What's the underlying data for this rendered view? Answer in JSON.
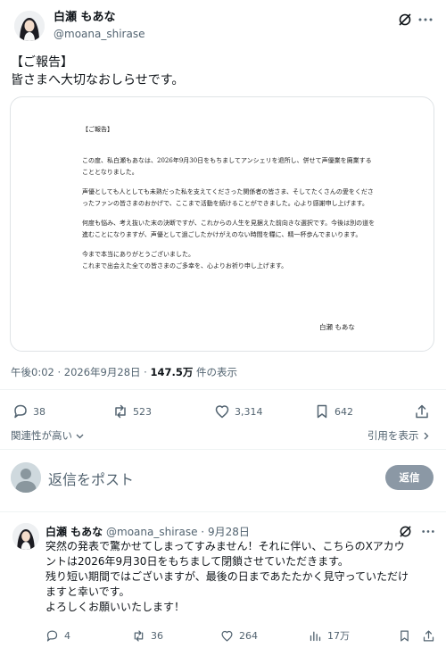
{
  "post": {
    "display_name": "白瀬 もあな",
    "handle": "@moana_shirase",
    "text_line1": "【ご報告】",
    "text_line2": "皆さまへ大切なおしらせです。"
  },
  "document": {
    "heading": "【ご報告】",
    "para1": "この度、私白瀬もあなは、2026年9月30日をもちましてアンシェリを退所し、併せて声優業を廃業することとなりました。",
    "para2": "声優としても人としても未熟だった私を支えてくださった関係者の皆さま、そしてたくさんの愛をくださったファンの皆さまのおかげで、ここまで活動を続けることができました。心より感謝申し上げます。",
    "para3": "何度も悩み、考え抜いた末の決断ですが、これからの人生を見据えた前向きな選択です。今後は別の道を進むことになりますが、声優として過ごしたかけがえのない時間を糧に、精一杯歩んでまいります。",
    "para4_line1": "今まで本当にありがとうございました。",
    "para4_line2": "これまで出会えた全ての皆さまのご多幸を、心よりお祈り申し上げます。",
    "signature": "白瀬 もあな"
  },
  "meta": {
    "time": "午後0:02 · 2026年9月28日 · ",
    "views_count": "147.5万",
    "views_label": " 件の表示"
  },
  "actions": {
    "replies": "38",
    "reposts": "523",
    "likes": "3,314",
    "bookmarks": "642"
  },
  "sort": {
    "relevance": "関連性が高い",
    "quotes": "引用を表示"
  },
  "composer": {
    "placeholder": "返信をポスト",
    "button": "返信"
  },
  "reply": {
    "display_name": "白瀬 もあな",
    "handle": "@moana_shirase",
    "separator": " · ",
    "date": "9月28日",
    "line1": "突然の発表で驚かせてしまってすみません！それに伴い、こちらのXアカウ",
    "line2": "ントは2026年9月30日をもちまして閉鎖させていただきます。",
    "line3": "残り短い期間ではございますが、最後の日まであたたかく見守っていただけ",
    "line4": "ますと幸いです。",
    "line5": "よろしくお願いいたします！",
    "replies": "4",
    "reposts": "36",
    "likes": "264",
    "views": "17万"
  },
  "icons": {
    "grok": "grok-icon",
    "more": "more-icon",
    "reply": "reply-icon",
    "repost": "repost-icon",
    "like": "like-icon",
    "bookmark": "bookmark-icon",
    "share": "share-icon",
    "views": "views-icon",
    "chevron": "chevron-down-icon",
    "arrow": "chevron-right-icon"
  },
  "colors": {
    "text_primary": "#0f1419",
    "text_secondary": "#536471",
    "reply_button_bg": "#8b98a5",
    "divider": "#eff3f4"
  }
}
